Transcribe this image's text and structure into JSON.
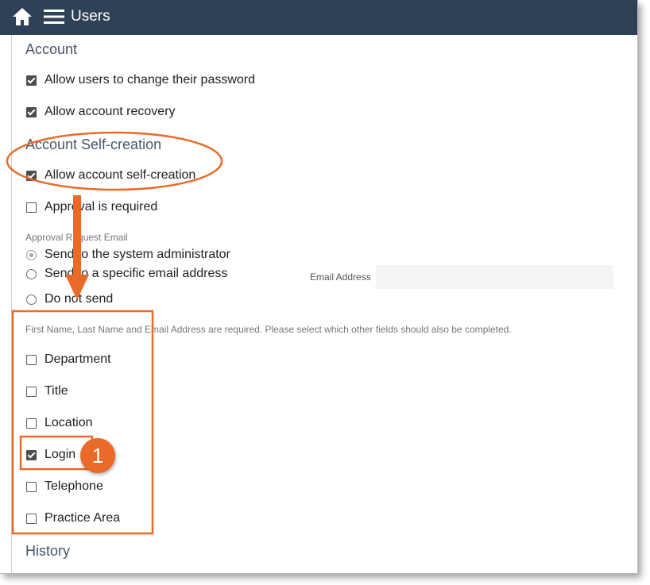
{
  "header": {
    "title": "Users",
    "home_icon": "home-icon",
    "menu_icon": "hamburger-menu-icon",
    "bg_color": "#2f4156"
  },
  "account": {
    "heading": "Account",
    "options": [
      {
        "label": "Allow users to change their password",
        "checked": true
      },
      {
        "label": "Allow account recovery",
        "checked": true
      }
    ]
  },
  "self_creation": {
    "heading": "Account Self-creation",
    "allow_label": "Allow account self-creation",
    "allow_checked": true,
    "approval_label": "Approval is required",
    "approval_checked": false
  },
  "approval_email": {
    "label": "Approval Request Email",
    "options": [
      {
        "label": "Send to the system administrator",
        "selected": true
      },
      {
        "label": "Send to a specific email address",
        "selected": false
      },
      {
        "label": "Do not send",
        "selected": false
      }
    ],
    "email_field_label": "Email Address",
    "email_value": ""
  },
  "fields": {
    "note": "First Name, Last Name and Email Address are required. Please select which other fields should also be completed.",
    "items": [
      {
        "label": "Department",
        "checked": false
      },
      {
        "label": "Title",
        "checked": false
      },
      {
        "label": "Location",
        "checked": false
      },
      {
        "label": "Login",
        "checked": true
      },
      {
        "label": "Telephone",
        "checked": false
      },
      {
        "label": "Practice Area",
        "checked": false
      }
    ]
  },
  "history": {
    "heading": "History"
  },
  "annotation": {
    "badge_number": "1",
    "accent_color": "#ea6a2a"
  }
}
